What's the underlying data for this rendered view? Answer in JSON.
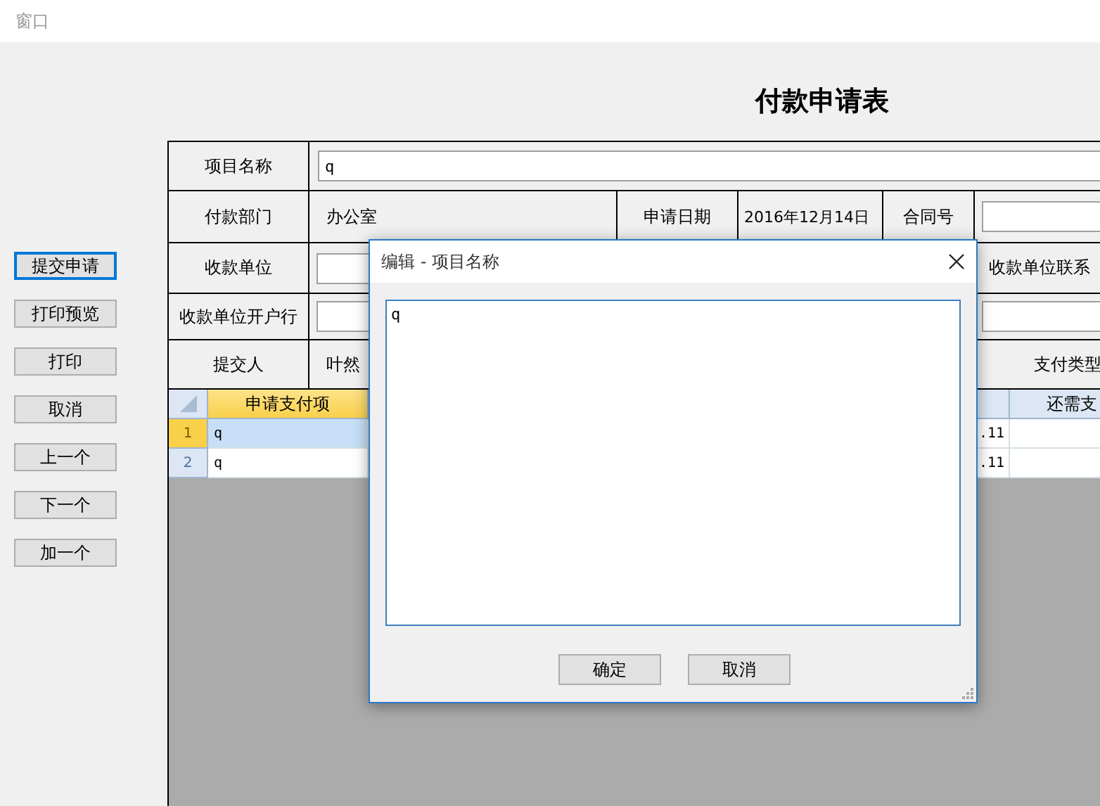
{
  "window": {
    "title": "窗口"
  },
  "form_title": "付款申请表",
  "side_buttons": [
    {
      "label": "提交申请",
      "focused": true
    },
    {
      "label": "打印预览",
      "focused": false
    },
    {
      "label": "打印",
      "focused": false
    },
    {
      "label": "取消",
      "focused": false
    },
    {
      "label": "上一个",
      "focused": false
    },
    {
      "label": "下一个",
      "focused": false
    },
    {
      "label": "加一个",
      "focused": false
    }
  ],
  "form": {
    "project_name": {
      "label": "项目名称",
      "value": "q"
    },
    "department": {
      "label": "付款部门",
      "value": "办公室"
    },
    "apply_date": {
      "label": "申请日期",
      "value": "2016年12月14日"
    },
    "contract_no": {
      "label": "合同号"
    },
    "payee": {
      "label": "收款单位"
    },
    "payee_contact": {
      "label": "收款单位联系"
    },
    "payee_bank": {
      "label": "收款单位开户行"
    },
    "submitter": {
      "label": "提交人",
      "value": "叶然"
    },
    "payment_type": {
      "label": "支付类型"
    }
  },
  "grid": {
    "columns": [
      "申请支付项",
      "还需支"
    ],
    "rows": [
      {
        "number": "1",
        "item": "q",
        "amount": ".11",
        "selected": true
      },
      {
        "number": "2",
        "item": "q",
        "amount": ".11",
        "selected": false
      }
    ]
  },
  "dialog": {
    "title": "编辑 - 项目名称",
    "text": "q",
    "buttons": [
      "确定",
      "取消"
    ]
  }
}
